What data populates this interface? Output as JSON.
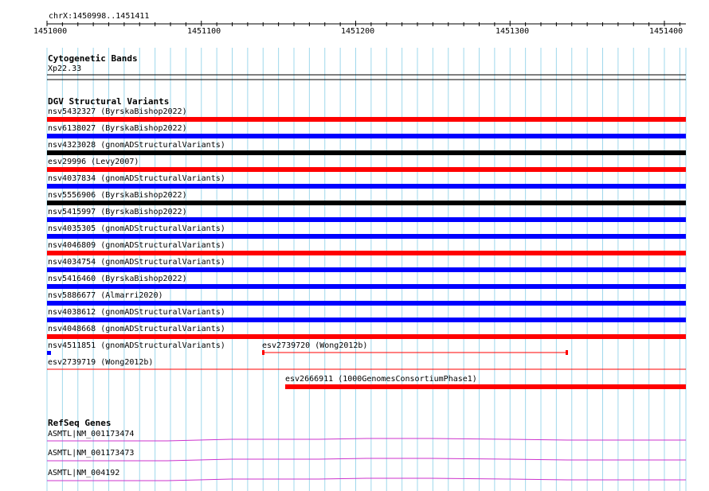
{
  "ruler": {
    "region": "chrX:1450998..1451411",
    "ticks": [
      "1451000",
      "1451100",
      "1451200",
      "1451300",
      "1451400"
    ]
  },
  "cytoband": {
    "title": "Cytogenetic Bands",
    "band": "Xp22.33"
  },
  "dgv": {
    "title": "DGV Structural Variants",
    "variants": [
      {
        "label": "nsv5432327 (ByrskaBishop2022)",
        "color": "#ff0000"
      },
      {
        "label": "nsv6138027 (ByrskaBishop2022)",
        "color": "#0000ff"
      },
      {
        "label": "nsv4323028 (gnomADStructuralVariants)",
        "color": "#000000"
      },
      {
        "label": "esv29996 (Levy2007)",
        "color": "#ff0000"
      },
      {
        "label": "nsv4037834 (gnomADStructuralVariants)",
        "color": "#0000ff"
      },
      {
        "label": "nsv5556906 (ByrskaBishop2022)",
        "color": "#000000"
      },
      {
        "label": "nsv5415997 (ByrskaBishop2022)",
        "color": "#0000ff"
      },
      {
        "label": "nsv4035305 (gnomADStructuralVariants)",
        "color": "#0000ff"
      },
      {
        "label": "nsv4046809 (gnomADStructuralVariants)",
        "color": "#ff0000"
      },
      {
        "label": "nsv4034754 (gnomADStructuralVariants)",
        "color": "#0000ff"
      },
      {
        "label": "nsv5416460 (ByrskaBishop2022)",
        "color": "#0000ff"
      },
      {
        "label": "nsv5886677 (Almarri2020)",
        "color": "#0000ff"
      },
      {
        "label": "nsv4038612 (gnomADStructuralVariants)",
        "color": "#0000ff"
      },
      {
        "label": "nsv4048668 (gnomADStructuralVariants)",
        "color": "#ff0000"
      }
    ],
    "small": {
      "nsv4511851": "nsv4511851 (gnomADStructuralVariants)",
      "esv2739720": "esv2739720 (Wong2012b)",
      "esv2739719": "esv2739719 (Wong2012b)",
      "esv2666911": "esv2666911 (1000GenomesConsortiumPhase1)"
    }
  },
  "refseq": {
    "title": "RefSeq Genes",
    "genes": [
      "ASMTL|NM_001173474",
      "ASMTL|NM_001173473",
      "ASMTL|NM_004192"
    ]
  },
  "colors": {
    "grid": "#9fd8ec",
    "gene": "#cc33cc",
    "red": "#ff0000",
    "blue": "#0000ff",
    "black": "#000000"
  }
}
